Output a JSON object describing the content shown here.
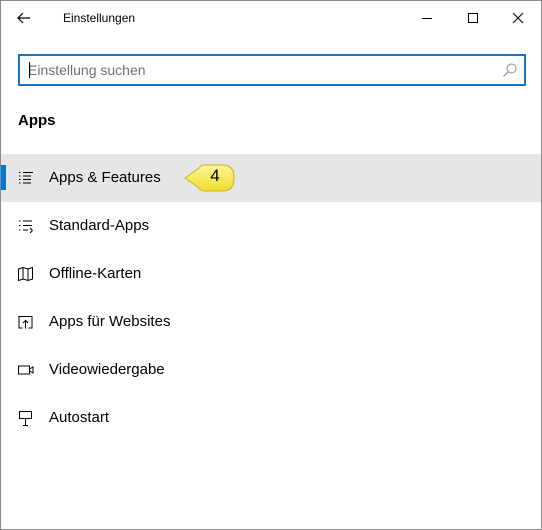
{
  "window": {
    "title": "Einstellungen",
    "back_icon": "arrow-left-icon",
    "controls": [
      "minimize-icon",
      "maximize-icon",
      "close-icon"
    ]
  },
  "search": {
    "placeholder": "Einstellung suchen",
    "value": "",
    "icon": "search-icon"
  },
  "section": {
    "title": "Apps"
  },
  "nav": {
    "items": [
      {
        "label": "Apps & Features",
        "icon": "apps-features-list-icon",
        "selected": true
      },
      {
        "label": "Standard-Apps",
        "icon": "default-apps-list-icon",
        "selected": false
      },
      {
        "label": "Offline-Karten",
        "icon": "map-icon",
        "selected": false
      },
      {
        "label": "Apps für Websites",
        "icon": "open-in-app-icon",
        "selected": false
      },
      {
        "label": "Videowiedergabe",
        "icon": "video-icon",
        "selected": false
      },
      {
        "label": "Autostart",
        "icon": "startup-icon",
        "selected": false
      }
    ]
  },
  "callout": {
    "number": "4",
    "color": "#f5e84a"
  },
  "colors": {
    "accent": "#0078d7",
    "selected_bg": "#e6e6e6",
    "search_border": "#1a73c0"
  }
}
